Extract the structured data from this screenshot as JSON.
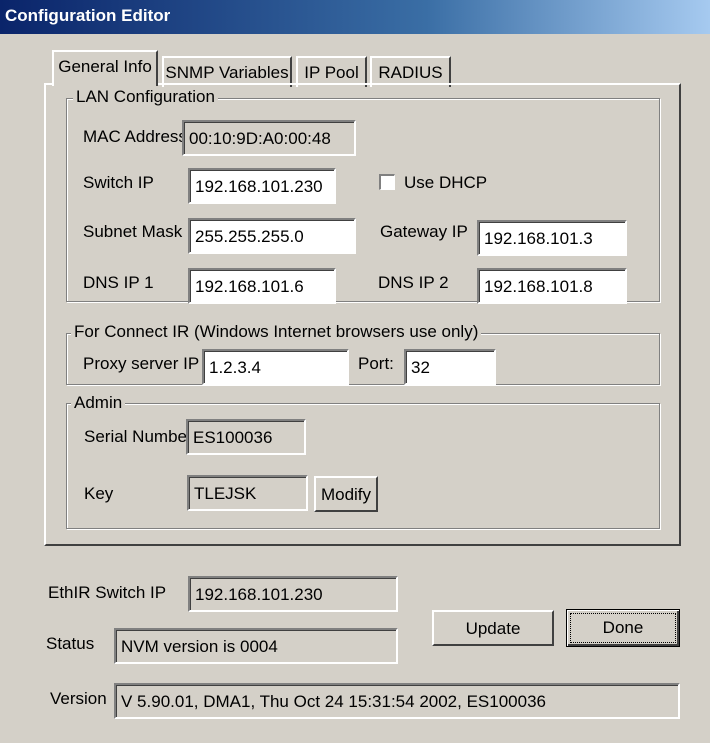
{
  "window": {
    "title": "Configuration Editor"
  },
  "tabs": [
    "General Info",
    "SNMP Variables",
    "IP Pool",
    "RADIUS"
  ],
  "lan": {
    "legend": "LAN Configuration",
    "mac_label": "MAC Address",
    "mac_value": "00:10:9D:A0:00:48",
    "switch_ip_label": "Switch IP",
    "switch_ip_value": "192.168.101.230",
    "use_dhcp_label": "Use DHCP",
    "use_dhcp_checked": false,
    "subnet_label": "Subnet Mask",
    "subnet_value": "255.255.255.0",
    "gateway_label": "Gateway IP",
    "gateway_value": "192.168.101.3",
    "dns1_label": "DNS IP 1",
    "dns1_value": "192.168.101.6",
    "dns2_label": "DNS IP 2",
    "dns2_value": "192.168.101.8"
  },
  "connect": {
    "legend": "For Connect IR (Windows Internet browsers use only)",
    "proxy_label": "Proxy server IP",
    "proxy_value": "1.2.3.4",
    "port_label": "Port:",
    "port_value": "32"
  },
  "admin": {
    "legend": "Admin",
    "serial_label": "Serial Number",
    "serial_value": "ES100036",
    "key_label": "Key",
    "key_value": "TLEJSK",
    "modify_label": "Modify"
  },
  "footer": {
    "ethir_label": "EthIR Switch IP",
    "ethir_value": "192.168.101.230",
    "status_label": "Status",
    "status_value": "NVM version is 0004",
    "update_label": "Update",
    "done_label": "Done",
    "version_label": "Version",
    "version_value": "V 5.90.01, DMA1, Thu Oct 24 15:31:54 2002, ES100036"
  }
}
